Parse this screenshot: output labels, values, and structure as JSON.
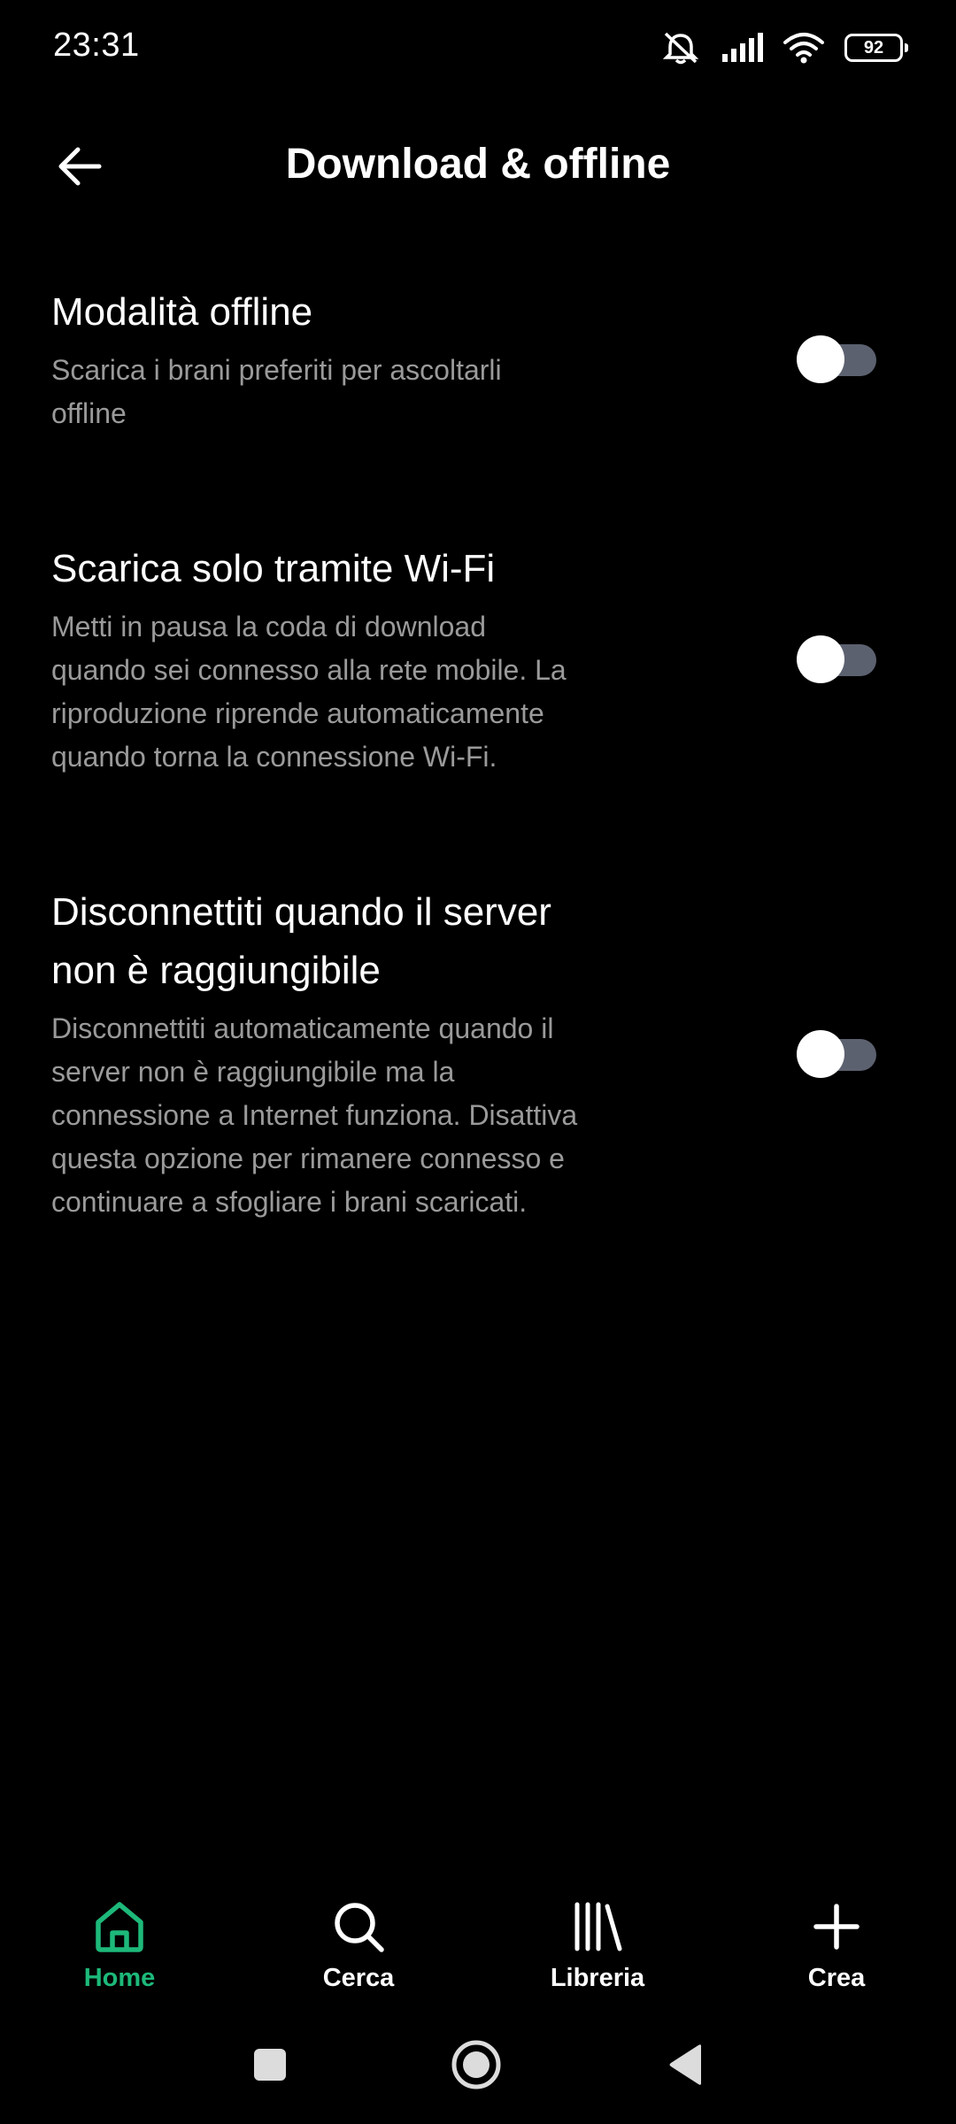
{
  "status_bar": {
    "time": "23:31",
    "battery_level": "92",
    "icons": [
      "mute-icon",
      "signal-icon",
      "wifi-icon",
      "battery-icon"
    ]
  },
  "header": {
    "title": "Download & offline",
    "back_icon": "arrow-left-icon"
  },
  "settings": [
    {
      "title": "Modalità offline",
      "description": "Scarica i brani preferiti per ascoltarli offline",
      "enabled": false
    },
    {
      "title": "Scarica solo tramite Wi-Fi",
      "description": "Metti in pausa la coda di download quando sei connesso alla rete mobile. La riproduzione riprende automaticamente quando torna la connessione Wi-Fi.",
      "enabled": false
    },
    {
      "title": "Disconnettiti quando il server non è raggiungibile",
      "description": "Disconnettiti automaticamente quando il server non è raggiungibile ma la connessione a Internet funziona. Disattiva questa opzione per rimanere connesso e continuare a sfogliare i brani scaricati.",
      "enabled": false
    }
  ],
  "bottom_nav": {
    "items": [
      {
        "label": "Home",
        "icon": "home-icon",
        "active": true
      },
      {
        "label": "Cerca",
        "icon": "search-icon",
        "active": false
      },
      {
        "label": "Libreria",
        "icon": "library-icon",
        "active": false
      },
      {
        "label": "Crea",
        "icon": "plus-icon",
        "active": false
      }
    ]
  },
  "colors": {
    "background": "#000000",
    "accent": "#1db97a",
    "text_primary": "#ffffff",
    "text_secondary": "#9a9a9a",
    "toggle_track_off": "#5c6170"
  },
  "system_nav": {
    "icons": [
      "recents-square-icon",
      "home-circle-icon",
      "back-triangle-icon"
    ]
  }
}
